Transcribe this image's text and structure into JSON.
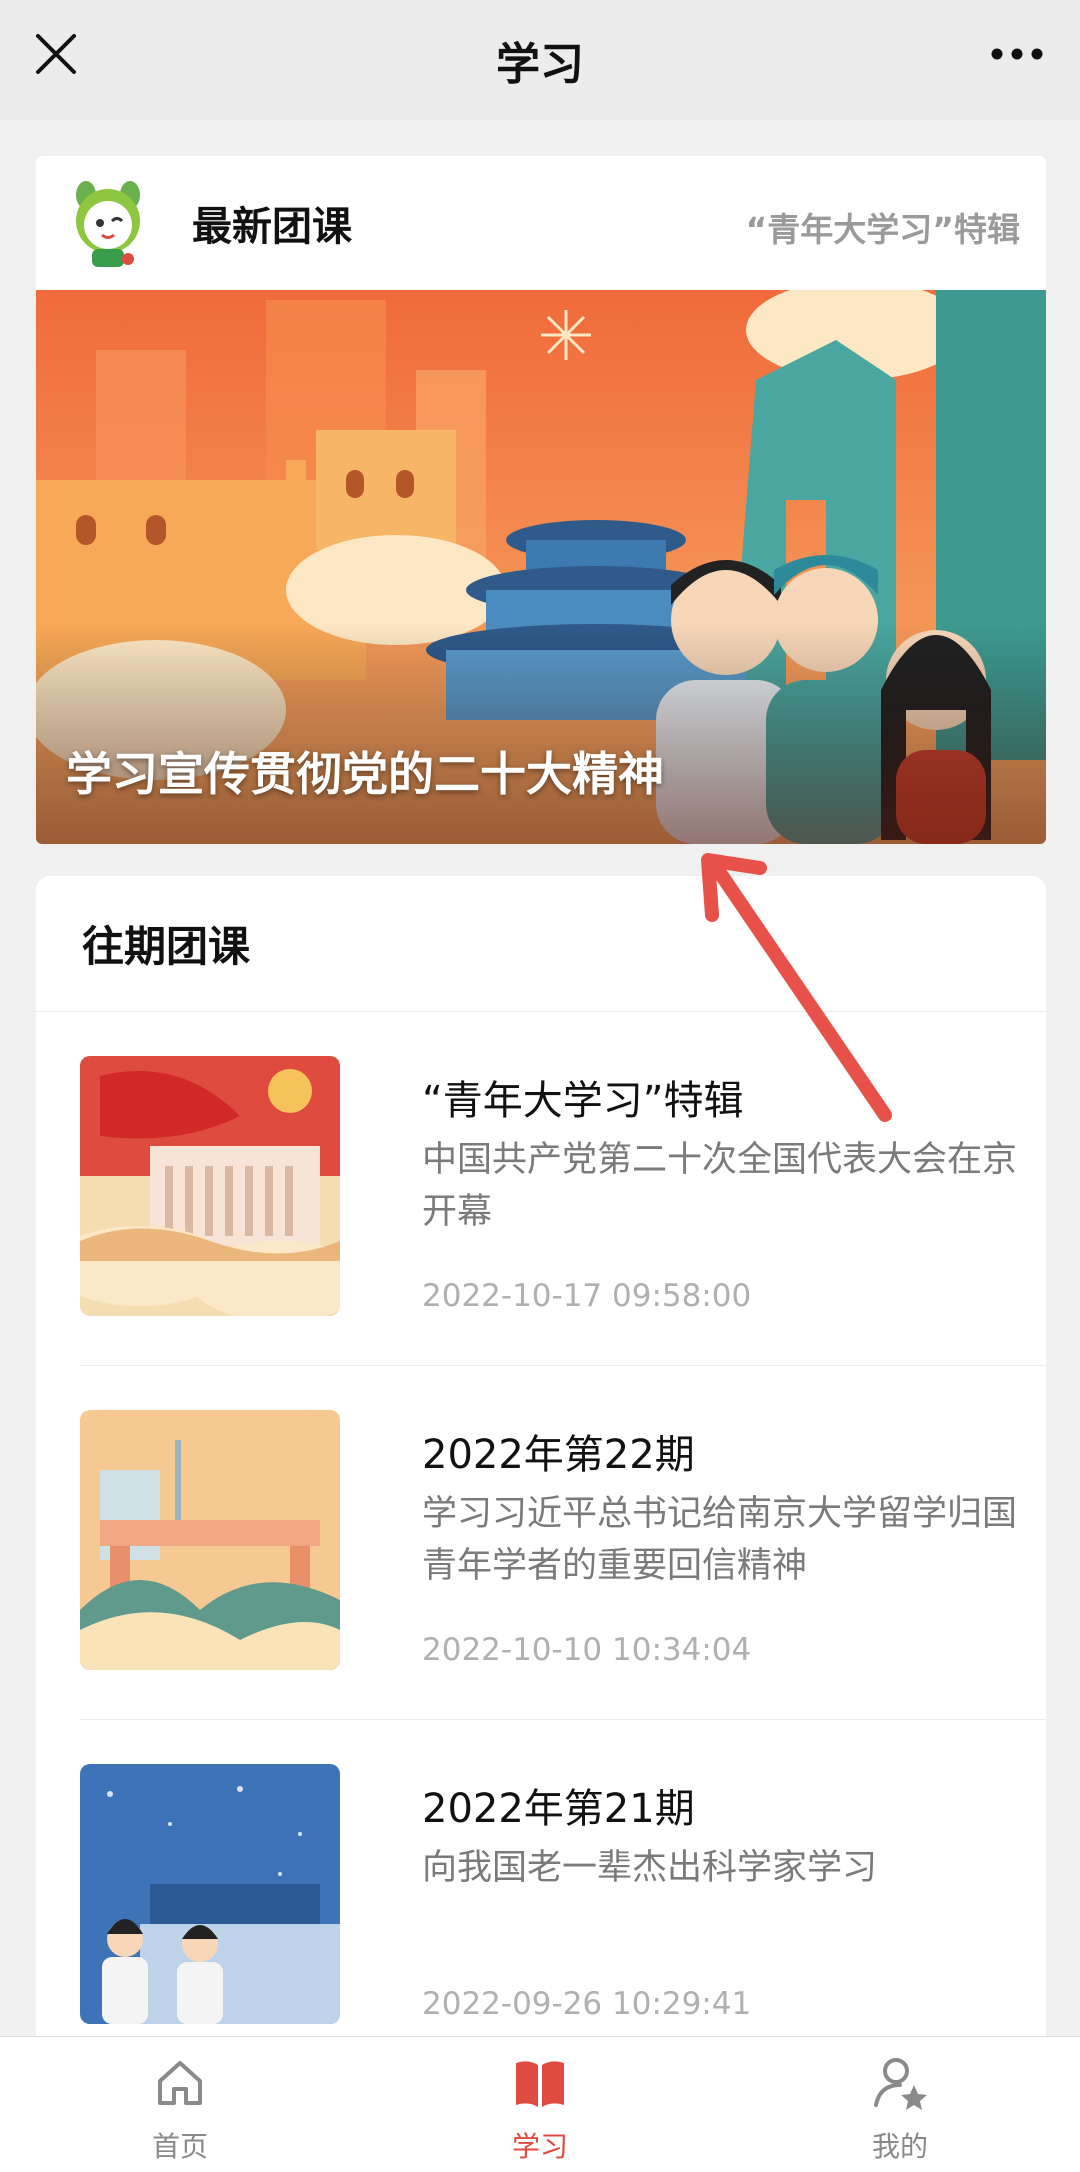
{
  "navbar": {
    "title": "学习",
    "close_icon": "close-icon",
    "more_icon": "more-dots-icon"
  },
  "latest": {
    "title": "最新团课",
    "special_link": "“青年大学习”特辑",
    "banner_caption": "学习宣传贯彻党的二十大精神"
  },
  "past": {
    "heading": "往期团课",
    "items": [
      {
        "title": "“青年大学习”特辑",
        "desc": "中国共产党第二十次全国代表大会在京开幕",
        "date": "2022-10-17 09:58:00"
      },
      {
        "title": "2022年第22期",
        "desc": "学习习近平总书记给南京大学留学归国青年学者的重要回信精神",
        "date": "2022-10-10 10:34:04"
      },
      {
        "title": "2022年第21期",
        "desc": "向我国老一辈杰出科学家学习",
        "date": "2022-09-26 10:29:41"
      }
    ]
  },
  "tabbar": {
    "items": [
      {
        "label": "首页",
        "icon": "home-icon"
      },
      {
        "label": "学习",
        "icon": "book-icon"
      },
      {
        "label": "我的",
        "icon": "profile-star-icon"
      }
    ],
    "active_color": "#e04b3f",
    "inactive_color": "#8a8a8a"
  },
  "annotation": {
    "arrow_color": "#e8504a"
  }
}
